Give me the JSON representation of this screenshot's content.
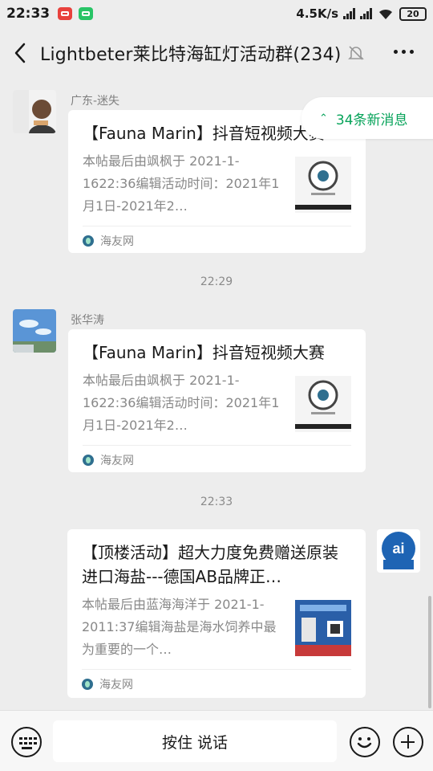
{
  "status_bar": {
    "time": "22:33",
    "network_speed": "4.5K/s",
    "battery": "20",
    "icons": [
      "red-app-icon",
      "green-app-icon",
      "signal-hd-icon",
      "signal-hd-icon",
      "wifi-icon",
      "battery-icon"
    ]
  },
  "header": {
    "title": "Lightbeter莱比特海缸灯活动群(234)",
    "icons": [
      "back-arrow-icon",
      "bell-muted-icon",
      "more-dots-icon"
    ]
  },
  "new_messages": {
    "label": "34条新消息",
    "color": "#07a35a"
  },
  "messages": [
    {
      "sender": "广东-迷失",
      "title": "【Fauna Marin】抖音短视频大赛",
      "desc": "本帖最后由飒枫于 2021-1-1622:36编辑活动时间：2021年1月1日-2021年2…",
      "source": "海友网"
    },
    {
      "timestamp": "22:29",
      "sender": "张华涛",
      "title": "【Fauna Marin】抖音短视频大赛",
      "desc": "本帖最后由飒枫于 2021-1-1622:36编辑活动时间：2021年1月1日-2021年2…",
      "source": "海友网"
    },
    {
      "timestamp": "22:33",
      "title": "【顶楼活动】超大力度免费赠送原装进口海盐---德国AB品牌正…",
      "desc": "本帖最后由蓝海海洋于 2021-1-2011:37编辑海盐是海水饲养中最为重要的一个…",
      "source": "海友网"
    }
  ],
  "input_bar": {
    "hold_to_talk": "按住 说话",
    "icons": [
      "keyboard-icon",
      "emoji-icon",
      "plus-icon"
    ]
  },
  "colors": {
    "background": "#ededed",
    "accent_green": "#07a35a"
  }
}
